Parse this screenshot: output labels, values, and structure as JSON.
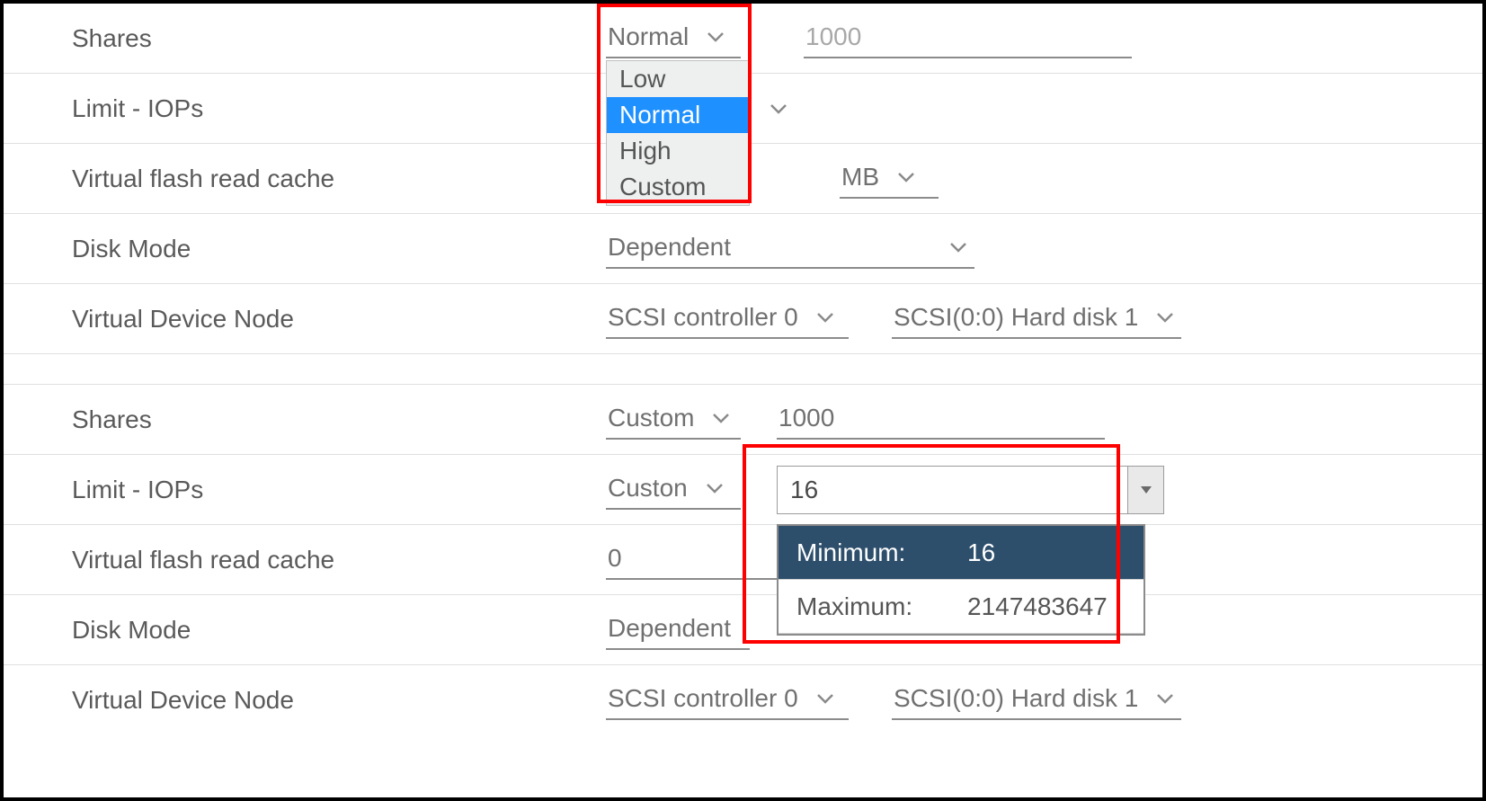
{
  "labels": {
    "shares": "Shares",
    "limit_iops": "Limit - IOPs",
    "vfrc": "Virtual flash read cache",
    "disk_mode": "Disk Mode",
    "vdn": "Virtual Device Node"
  },
  "top": {
    "shares_select": "Normal",
    "shares_value": "1000",
    "shares_options": [
      "Low",
      "Normal",
      "High",
      "Custom"
    ],
    "shares_selected_index": 1,
    "vfrc_unit": "MB",
    "disk_mode": "Dependent",
    "vdn_controller": "SCSI controller 0",
    "vdn_disk": "SCSI(0:0) Hard disk 1"
  },
  "bottom": {
    "shares_select": "Custom",
    "shares_value": "1000",
    "limit_select": "Custon",
    "limit_value": "16",
    "range_min_label": "Minimum:",
    "range_min_value": "16",
    "range_max_label": "Maximum:",
    "range_max_value": "2147483647",
    "vfrc_value": "0",
    "disk_mode": "Dependent",
    "vdn_controller": "SCSI controller 0",
    "vdn_disk": "SCSI(0:0) Hard disk 1"
  }
}
